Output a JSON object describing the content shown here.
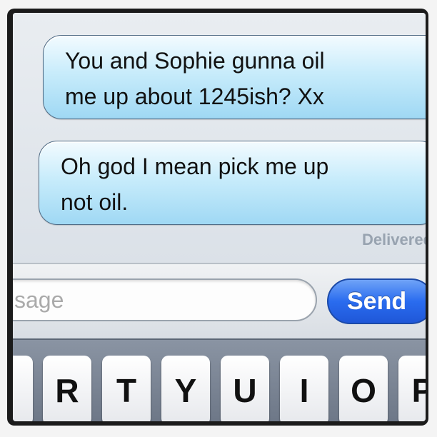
{
  "messages": [
    {
      "text_line1": "You and Sophie gunna oil",
      "text_line2": "me up about 1245ish? Xx"
    },
    {
      "text_line1": "Oh god I mean pick me up",
      "text_line2": "not oil."
    }
  ],
  "status": "Delivered",
  "input": {
    "placeholder": "sage"
  },
  "send_button": {
    "label": "Send"
  },
  "keyboard": {
    "keys": [
      "",
      "R",
      "T",
      "Y",
      "U",
      "I",
      "O",
      "P"
    ]
  },
  "colors": {
    "bubble_border": "#4f6b85",
    "send_button": "#2a6cef",
    "keyboard_bg": "#7a8493"
  }
}
